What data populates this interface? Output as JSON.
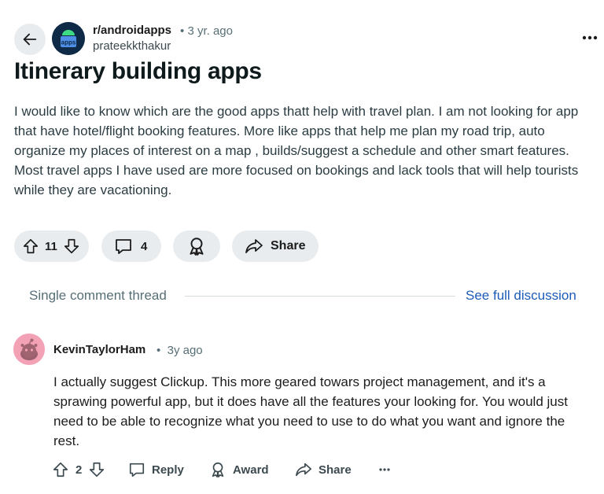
{
  "post": {
    "subreddit": "r/androidapps",
    "subreddit_icon_text": "apps",
    "separator": "•",
    "time": "3 yr. ago",
    "author": "prateekkthakur",
    "title": "Itinerary building apps",
    "body": "I would like to know which are the good apps thatt help with travel plan. I am not looking for app that have hotel/flight booking features. More like apps that help me plan my road trip, auto organize my places of interest on a map , builds/suggest a schedule and other smart features. Most travel apps I have used are more focused on bookings and lack tools that will help tourists while they are vacationing."
  },
  "actions": {
    "votes": "11",
    "comments": "4",
    "share_label": "Share"
  },
  "thread": {
    "label": "Single comment thread",
    "see_full": "See full discussion"
  },
  "comment": {
    "author": "KevinTaylorHam",
    "separator": "•",
    "time": "3y ago",
    "body": "I actually suggest Clickup. This more geared towars project management, and it's a sprawing powerful app, but it does have all the features your looking for. You would just need to be able to recognize what you need to use to do what you want and ignore the rest.",
    "votes": "2",
    "reply_label": "Reply",
    "award_label": "Award",
    "share_label": "Share"
  },
  "colors": {
    "pill_bg": "#e9ecee",
    "link": "#1d5bb8",
    "muted": "#576f76",
    "subreddit_icon_bg": "#0e2a47",
    "comment_avatar_bg": "#f3a2b6"
  },
  "icons": [
    "arrow-left-icon",
    "subreddit-icon",
    "overflow-menu-icon",
    "upvote-icon",
    "downvote-icon",
    "comment-icon",
    "award-icon",
    "share-icon",
    "reply-icon",
    "snoo-avatar-icon"
  ]
}
